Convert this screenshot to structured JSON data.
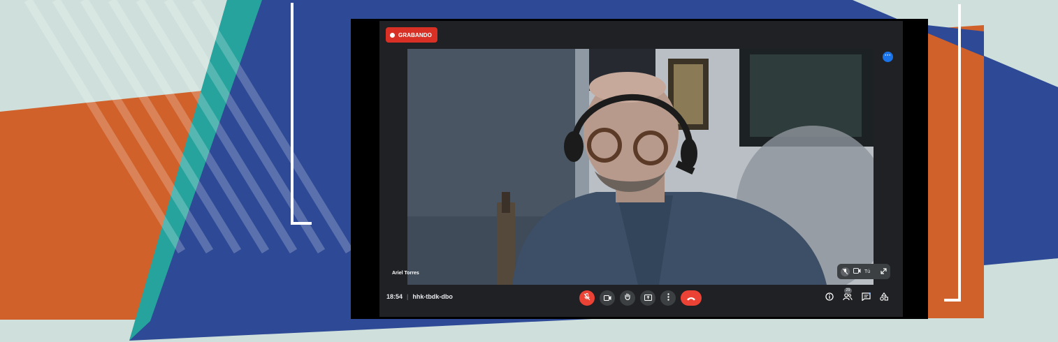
{
  "colors": {
    "background": "#cfe0dc",
    "orange": "#d0612a",
    "navy": "#2e4a96",
    "teal": "#27a39d",
    "record_red": "#d93025",
    "end_call_red": "#ea4335",
    "meet_dark": "#202124",
    "accent_blue": "#1a73e8"
  },
  "meeting": {
    "recording_label": "GRABANDO",
    "participant_name": "Ariel Torres",
    "self_label": "Tú",
    "time": "18:54",
    "separator": "|",
    "meeting_code": "hhk-tbdk-dbo",
    "people_count": "29"
  },
  "icons": {
    "more_options": "more-horizontal-icon",
    "mic": "mic-off-icon",
    "camera": "camera-icon",
    "raise_hand": "raise-hand-icon",
    "present": "present-screen-icon",
    "more": "more-vertical-icon",
    "end_call": "end-call-icon",
    "info": "info-icon",
    "people": "people-icon",
    "chat": "chat-icon",
    "activities": "activities-icon",
    "expand": "expand-icon"
  }
}
